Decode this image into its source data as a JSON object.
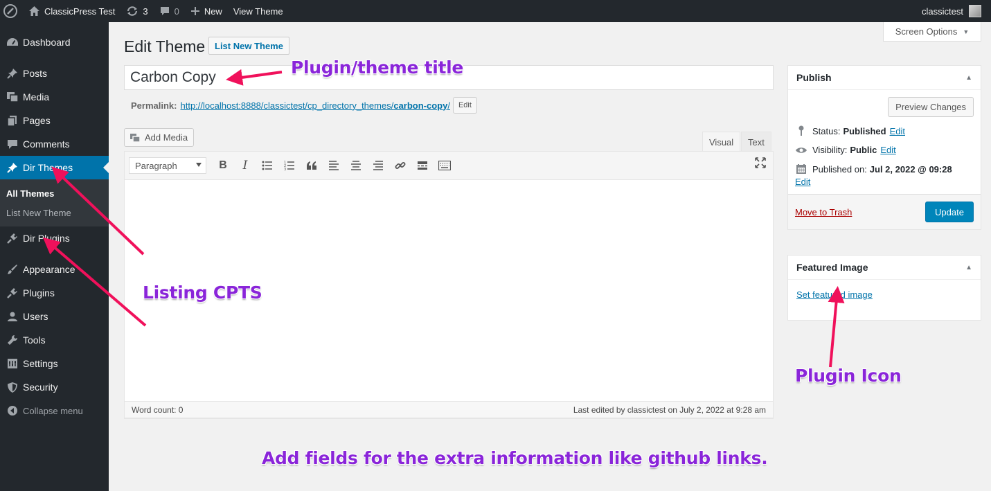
{
  "admin_bar": {
    "site_name": "ClassicPress Test",
    "updates_count": "3",
    "comments_count": "0",
    "new_label": "New",
    "view_label": "View Theme",
    "user_name": "classictest"
  },
  "sidebar": {
    "items": [
      {
        "label": "Dashboard",
        "icon": "dashboard-icon"
      },
      {
        "label": "Posts",
        "icon": "pin-icon"
      },
      {
        "label": "Media",
        "icon": "media-icon"
      },
      {
        "label": "Pages",
        "icon": "pages-icon"
      },
      {
        "label": "Comments",
        "icon": "comments-icon"
      },
      {
        "label": "Dir Themes",
        "icon": "pin-icon"
      },
      {
        "label": "Dir Plugins",
        "icon": "plugin-icon"
      },
      {
        "label": "Appearance",
        "icon": "appearance-icon"
      },
      {
        "label": "Plugins",
        "icon": "plugin-icon"
      },
      {
        "label": "Users",
        "icon": "users-icon"
      },
      {
        "label": "Tools",
        "icon": "tools-icon"
      },
      {
        "label": "Settings",
        "icon": "settings-icon"
      },
      {
        "label": "Security",
        "icon": "shield-icon"
      }
    ],
    "submenu": [
      "All Themes",
      "List New Theme"
    ],
    "collapse_label": "Collapse menu"
  },
  "header": {
    "screen_options": "Screen Options",
    "title": "Edit Theme",
    "add_new_label": "List New Theme"
  },
  "post": {
    "title": "Carbon Copy",
    "permalink_label": "Permalink:",
    "permalink_base": "http://localhost:8888/classictest/cp_directory_themes/",
    "permalink_slug": "carbon-copy",
    "permalink_suffix": "/",
    "permalink_edit": "Edit"
  },
  "editor": {
    "add_media": "Add Media",
    "tab_visual": "Visual",
    "tab_text": "Text",
    "format_select": "Paragraph",
    "word_count": "Word count: 0",
    "last_edited": "Last edited by classictest on July 2, 2022 at 9:28 am"
  },
  "publish": {
    "title": "Publish",
    "preview": "Preview Changes",
    "status_label": "Status:",
    "status_value": "Published",
    "visibility_label": "Visibility:",
    "visibility_value": "Public",
    "published_label": "Published on:",
    "published_value": "Jul 2, 2022 @ 09:28",
    "edit": "Edit",
    "trash": "Move to Trash",
    "update": "Update"
  },
  "featured": {
    "title": "Featured Image",
    "link": "Set featured image"
  },
  "annotations": {
    "title_note": "Plugin/theme title",
    "cpts_note": "Listing CPTS",
    "icon_note": "Plugin Icon",
    "fields_note": "Add fields for the extra information like github links.",
    "color": "#8a25d9",
    "arrow_color": "#f0115b"
  },
  "colors": {
    "admin_bar": "#23282d",
    "accent": "#0073aa",
    "primary_button": "#0085ba",
    "trash": "#aa0000"
  }
}
